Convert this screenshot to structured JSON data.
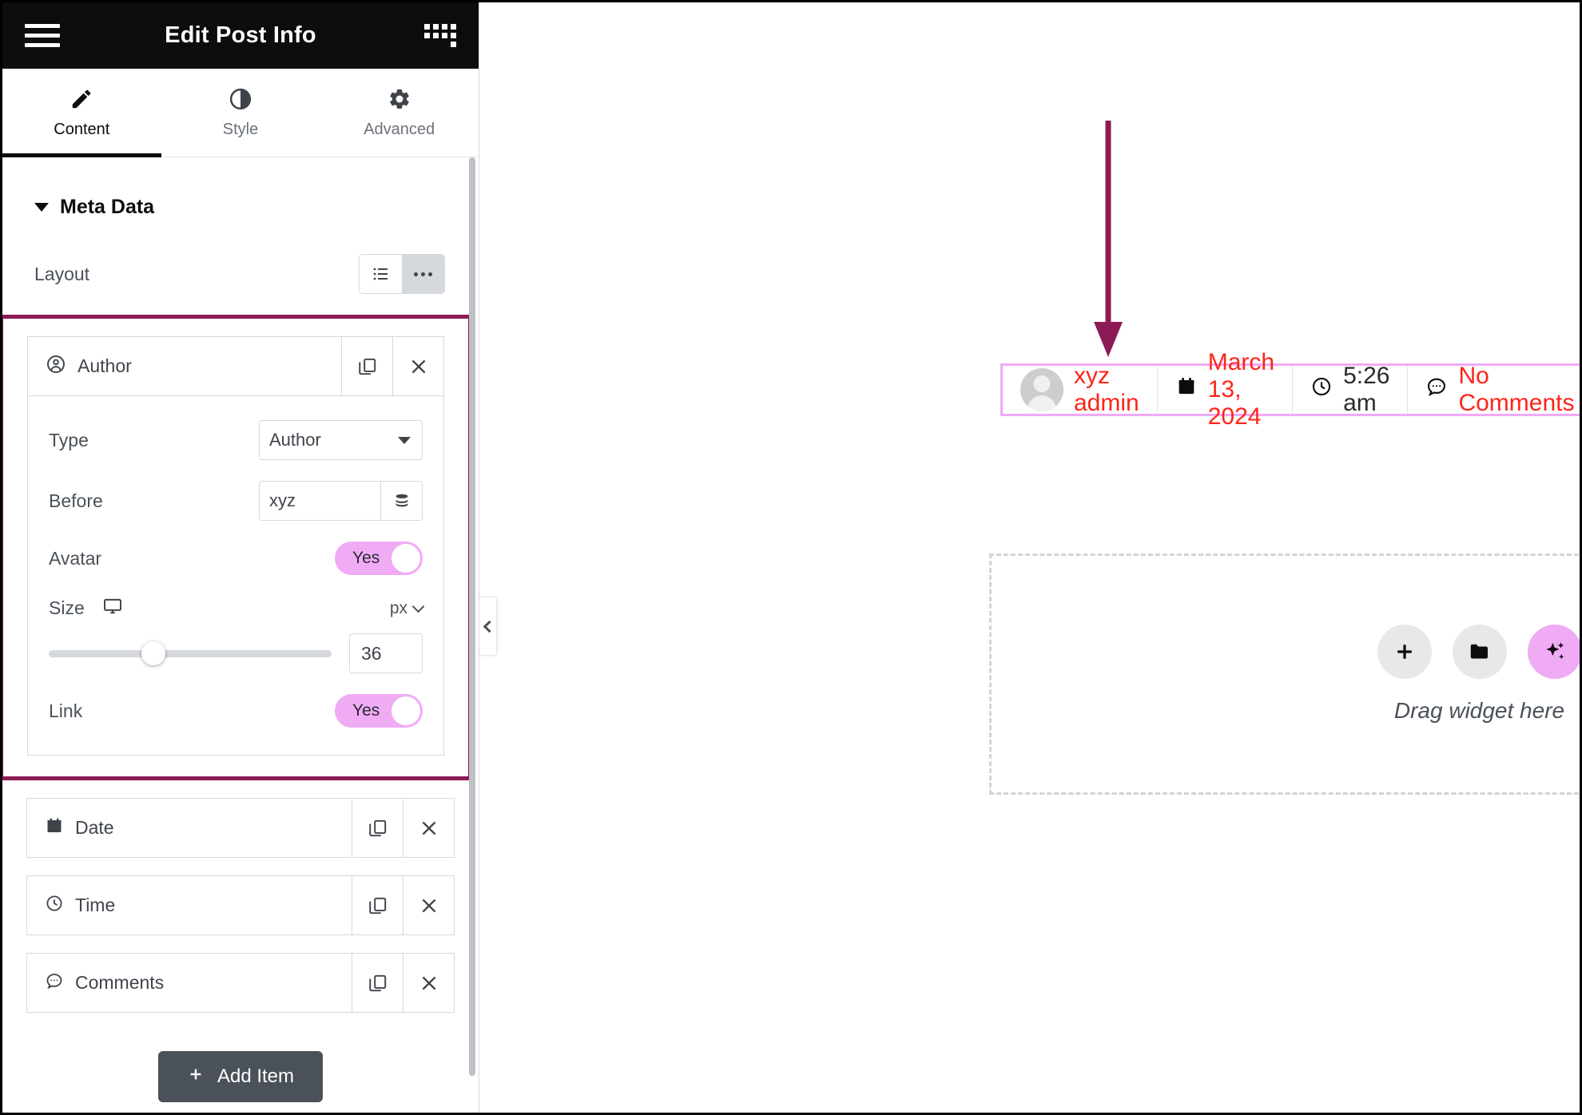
{
  "panel": {
    "title": "Edit Post Info",
    "menu_icon": "hamburger-icon",
    "apps_icon": "grid-apps-icon",
    "tabs": [
      {
        "label": "Content",
        "icon": "pencil-icon",
        "active": true
      },
      {
        "label": "Style",
        "icon": "contrast-icon",
        "active": false
      },
      {
        "label": "Advanced",
        "icon": "gear-icon",
        "active": false
      }
    ],
    "section": {
      "title": "Meta Data"
    },
    "layout": {
      "label": "Layout",
      "options": [
        "list-icon",
        "inline-dots-icon"
      ],
      "selected": "inline-dots-icon"
    },
    "items": [
      {
        "label": "Author",
        "icon": "user-circle-icon"
      },
      {
        "label": "Date",
        "icon": "calendar-icon"
      },
      {
        "label": "Time",
        "icon": "clock-icon"
      },
      {
        "label": "Comments",
        "icon": "comment-icon"
      }
    ],
    "author_controls": {
      "type": {
        "label": "Type",
        "value": "Author"
      },
      "before": {
        "label": "Before",
        "value": "xyz",
        "placeholder": ""
      },
      "avatar": {
        "label": "Avatar",
        "value": "Yes"
      },
      "size": {
        "label": "Size",
        "unit": "px",
        "value": "36",
        "device": "desktop-icon"
      },
      "link": {
        "label": "Link",
        "value": "Yes"
      }
    },
    "row_actions": {
      "duplicate": "duplicate-icon",
      "remove": "close-icon"
    },
    "add_item": {
      "label": "Add Item",
      "icon": "plus-icon"
    }
  },
  "canvas": {
    "collapse_handle": "chevron-left-icon",
    "annotation": {
      "type": "down-arrow",
      "color": "#8c1b55"
    },
    "meta_bar": {
      "border_color": "#f0abf5",
      "items": [
        {
          "name": "author",
          "icon": "avatar-image",
          "text": "xyz admin",
          "color": "#ff2419"
        },
        {
          "name": "date",
          "icon": "calendar-icon",
          "text": "March 13, 2024",
          "color": "#ff2419"
        },
        {
          "name": "time",
          "icon": "clock-icon",
          "text": "5:26 am",
          "color": "#2b2b2b"
        },
        {
          "name": "comments",
          "icon": "comment-icon",
          "text": "No Comments",
          "color": "#ff2419"
        }
      ]
    },
    "dropzone": {
      "label": "Drag widget here",
      "buttons": [
        {
          "name": "add-element-button",
          "icon": "plus-icon"
        },
        {
          "name": "add-template-button",
          "icon": "folder-icon"
        },
        {
          "name": "ai-button",
          "icon": "sparkles-icon"
        }
      ]
    }
  },
  "colors": {
    "accent_pink": "#f0abf5",
    "highlight_maroon": "#8c1b55",
    "link_red": "#ff2419",
    "dark": "#0c0d0e"
  }
}
